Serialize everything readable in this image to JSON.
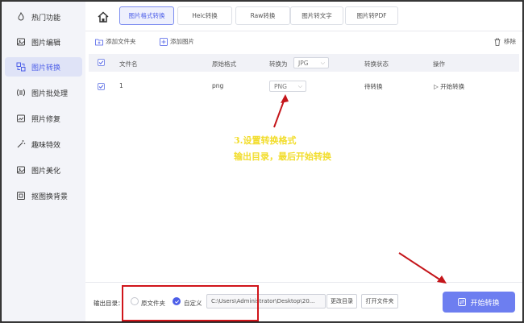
{
  "sidebar": {
    "items": [
      {
        "label": "热门功能",
        "icon": "hot-icon",
        "active": false
      },
      {
        "label": "图片编辑",
        "icon": "image-edit-icon",
        "active": false
      },
      {
        "label": "图片转换",
        "icon": "image-convert-icon",
        "active": true
      },
      {
        "label": "图片批处理",
        "icon": "batch-icon",
        "active": false
      },
      {
        "label": "照片修复",
        "icon": "photo-repair-icon",
        "active": false
      },
      {
        "label": "趣味特效",
        "icon": "effects-icon",
        "active": false
      },
      {
        "label": "图片美化",
        "icon": "beautify-icon",
        "active": false
      },
      {
        "label": "抠图换背景",
        "icon": "cutout-icon",
        "active": false
      }
    ]
  },
  "tabs": [
    {
      "label": "图片格式转换",
      "active": true
    },
    {
      "label": "Heic转换",
      "active": false
    },
    {
      "label": "Raw转换",
      "active": false
    },
    {
      "label": "图片转文字",
      "active": false
    },
    {
      "label": "图片转PDF",
      "active": false
    }
  ],
  "toolbar": {
    "add_folder": "添加文件夹",
    "add_image": "添加图片",
    "remove": "移除"
  },
  "table": {
    "headers": {
      "name": "文件名",
      "original_format": "原始格式",
      "convert_to": "转换为",
      "status": "转换状态",
      "action": "操作"
    },
    "header_format_select": "JPG",
    "rows": [
      {
        "name": "1",
        "original_format": "png",
        "target_format": "PNG",
        "status": "待转换",
        "action": "开始转换"
      }
    ]
  },
  "annotation": {
    "line1": "3.设置转换格式",
    "line2": "输出目录，最后开始转换"
  },
  "footer": {
    "output_label": "输出目录：",
    "source_folder": "原文件夹",
    "custom": "自定义",
    "path": "C:\\Users\\Administrator\\Desktop\\20...",
    "change_dir": "更改目录",
    "open_folder": "打开文件夹",
    "start_button": "开始转换"
  },
  "colors": {
    "accent": "#4c5ee8",
    "start_button": "#6d7ef0",
    "annotation_text": "#f2dd2c",
    "annotation_red": "#d0151a"
  }
}
